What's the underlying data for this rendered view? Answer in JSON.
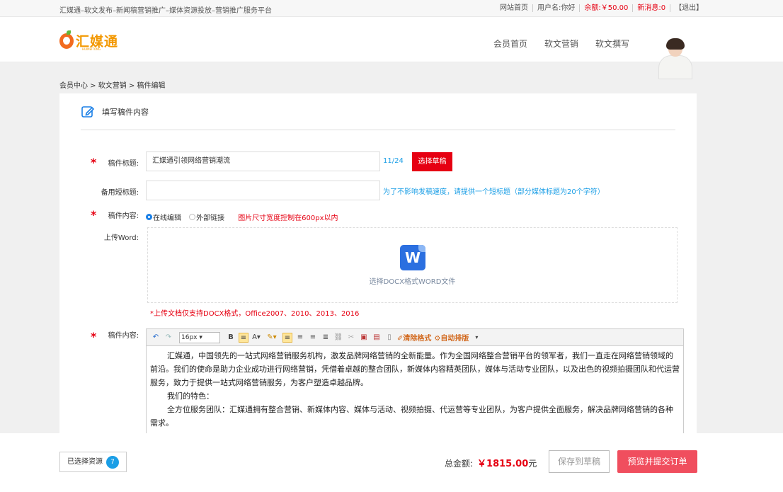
{
  "topbar": {
    "slogan": "汇媒通–软文发布–新闻稿营销推广–媒体资源投放–营销推广服务平台",
    "home": "网站首页",
    "user": "用户名:你好",
    "balance": "余额:￥50.00",
    "messages": "新消息:0",
    "logout": "【退出】"
  },
  "header": {
    "logo_text": "汇媒通",
    "logo_sub": "HUIMEITONG",
    "nav": [
      "会员首页",
      "软文营销",
      "软文撰写"
    ]
  },
  "breadcrumb": "会员中心 > 软文营销 > 稿件编辑",
  "panel": {
    "title": "填写稿件内容"
  },
  "form": {
    "title_label": "稿件标题:",
    "title_value": "汇媒通引领网络营销潮流",
    "title_count": "11/24",
    "select_draft": "选择草稿",
    "short_label": "备用短标题:",
    "short_value": "",
    "short_hint": "为了不影响发稿速度，请提供一个短标题（部分媒体标题为20个字符）",
    "content_label": "稿件内容:",
    "radio_online": "在线编辑",
    "radio_link": "外部链接",
    "image_hint": "图片尺寸宽度控制在600px以内",
    "upload_label": "上传Word:",
    "upload_text": "选择DOCX格式WORD文件",
    "upload_note": "*上传文档仅支持DOCX格式，Office2007、2010、2013、2016",
    "editor_label": "稿件内容:"
  },
  "editor": {
    "font_size": "16px",
    "clear_format": "清除格式",
    "auto_layout": "自动排版",
    "paragraphs": [
      "汇媒通，中国领先的一站式网络营销服务机构，激发品牌网络营销的全新能量。作为全国网络整合营销平台的领军者，我们一直走在网络营销领域的前沿。我们的使命是助力企业成功进行网络营销，凭借着卓越的整合团队，新媒体内容精英团队，媒体与活动专业团队，以及出色的视频拍摄团队和代运营服务，致力于提供一站式网络营销服务，为客户塑造卓越品牌。",
      "我们的特色：",
      "全方位服务团队：汇媒通拥有整合营销、新媒体内容、媒体与活动、视频拍摄、代运营等专业团队，为客户提供全面服务，解决品牌网络营销的各种需求。"
    ]
  },
  "footer": {
    "selected_resources": "已选择资源",
    "resource_count": "7",
    "total_label": "总金额:",
    "total_amount": "￥1815.00",
    "total_unit": "元",
    "save_draft": "保存到草稿",
    "submit": "预览并提交订单"
  },
  "colors": {
    "accent_red": "#e60012",
    "link_blue": "#1a9ee6",
    "submit_pink": "#f04e5e"
  }
}
